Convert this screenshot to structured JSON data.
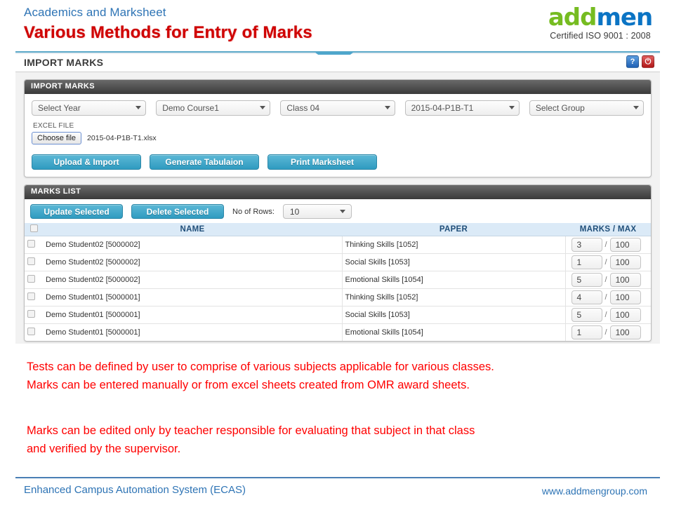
{
  "header": {
    "subtitle": "Academics and Marksheet",
    "title": "Various Methods for Entry of Marks",
    "logo": {
      "part1": "add",
      "part2": "men",
      "certification": "Certified ISO 9001 : 2008"
    },
    "accent_color": "#4FA6CC",
    "title_color": "#D00000",
    "subtitle_color": "#2E74B5"
  },
  "app": {
    "topbar_title": "IMPORT MARKS",
    "help_icon": "question-mark-icon",
    "power_icon": "power-icon",
    "import_panel": {
      "heading": "IMPORT MARKS",
      "selects": [
        {
          "name": "year",
          "value": "Select Year"
        },
        {
          "name": "course",
          "value": "Demo Course1"
        },
        {
          "name": "class",
          "value": "Class 04"
        },
        {
          "name": "test",
          "value": "2015-04-P1B-T1"
        },
        {
          "name": "group",
          "value": "Select Group"
        }
      ],
      "excel_label": "EXCEL FILE",
      "choose_file_label": "Choose file",
      "file_name": "2015-04-P1B-T1.xlsx",
      "buttons": [
        "Upload & Import",
        "Generate Tabulaion",
        "Print Marksheet"
      ]
    },
    "marks_panel": {
      "heading": "MARKS LIST",
      "update_label": "Update Selected",
      "delete_label": "Delete Selected",
      "rows_label": "No of Rows:",
      "rows_value": "10",
      "columns": [
        "",
        "NAME",
        "PAPER",
        "MARKS / MAX"
      ],
      "rows": [
        {
          "name": "Demo Student02 [5000002]",
          "paper": "Thinking Skills [1052]",
          "marks": "3",
          "max": "100"
        },
        {
          "name": "Demo Student02 [5000002]",
          "paper": "Social Skills [1053]",
          "marks": "1",
          "max": "100"
        },
        {
          "name": "Demo Student02 [5000002]",
          "paper": "Emotional Skills [1054]",
          "marks": "5",
          "max": "100"
        },
        {
          "name": "Demo Student01 [5000001]",
          "paper": "Thinking Skills [1052]",
          "marks": "4",
          "max": "100"
        },
        {
          "name": "Demo Student01 [5000001]",
          "paper": "Social Skills [1053]",
          "marks": "5",
          "max": "100"
        },
        {
          "name": "Demo Student01 [5000001]",
          "paper": "Emotional Skills [1054]",
          "marks": "1",
          "max": "100"
        }
      ]
    }
  },
  "notes": {
    "para1_line1": "Tests can be defined by user to comprise of various subjects applicable for various classes.",
    "para1_line2": "Marks can be entered manually or from excel sheets created from OMR award sheets.",
    "para2_line1": "Marks can be edited only by teacher responsible for evaluating that subject in that class",
    "para2_line2": "and verified by the supervisor.",
    "color": "#FF0000"
  },
  "footer": {
    "left": "Enhanced Campus Automation System (ECAS)",
    "right": "www.addmengroup.com",
    "color": "#2E74B5"
  }
}
